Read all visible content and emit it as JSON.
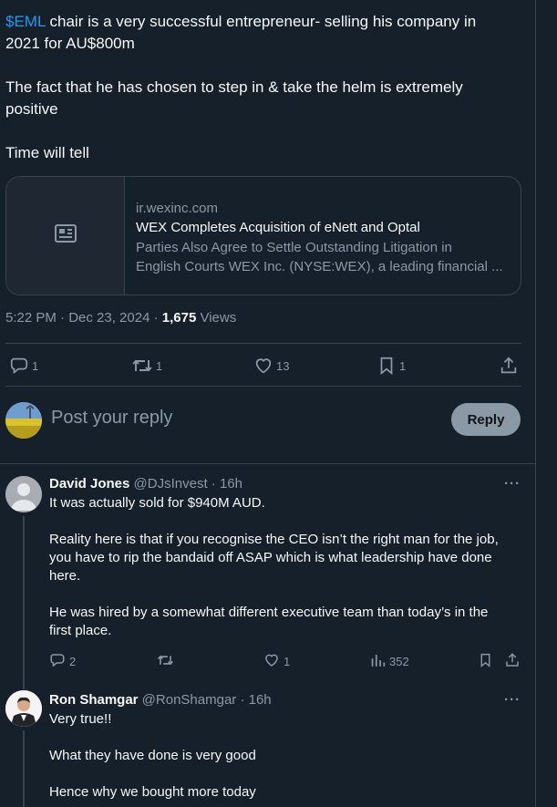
{
  "tweet": {
    "cashtag": "$EML",
    "line1_rest": " chair is a very successful entrepreneur- selling his company in",
    "line2": "2021 for AU$800m",
    "para2_l1": "The fact that he has chosen to step in & take the helm is extremely",
    "para2_l2": "positive",
    "para3": "Time will tell"
  },
  "card": {
    "domain": "ir.wexinc.com",
    "title": "WEX Completes Acquisition of eNett and Optal",
    "desc_l1": "Parties Also Agree to Settle Outstanding Litigation in",
    "desc_l2": "English Courts WEX Inc. (NYSE:WEX), a leading financial ..."
  },
  "meta": {
    "time": "5:22 PM · Dec 23, 2024 · ",
    "views_count": "1,675",
    "views_label": " Views"
  },
  "actions": {
    "replies": "1",
    "reposts": "1",
    "likes": "13",
    "bookmarks": "1"
  },
  "reply_box": {
    "placeholder": "Post your reply",
    "button": "Reply"
  },
  "replies": [
    {
      "name": "David Jones",
      "handle": " @DJsInvest · 16h",
      "more": "···",
      "p1": "It was actually sold for $940M AUD.",
      "p2_l1": "Reality here is that if you recognise the CEO isn’t the right man for the job,",
      "p2_l2": "you have to rip the bandaid off ASAP which is what leadership have done",
      "p2_l3": "here.",
      "p3_l1": "He was hired by a somewhat different executive team than today’s in the",
      "p3_l2": "first place.",
      "replies": "2",
      "likes": "1",
      "views": "352"
    },
    {
      "name": "Ron Shamgar",
      "handle": " @RonShamgar · 16h",
      "more": "···",
      "p1": "Very true!!",
      "p2": "What they have done is very good",
      "p3": "Hence why we bought more today"
    }
  ],
  "icons": {
    "reply": "speech-bubble-icon",
    "repost": "repost-arrows-icon",
    "like": "heart-icon",
    "bookmark": "bookmark-icon",
    "share": "share-upload-icon",
    "views": "bar-chart-icon",
    "card": "article-icon"
  },
  "colors": {
    "background": "#15202b",
    "accent": "#1d9bf0",
    "muted": "#8b98a5",
    "border": "#38444d"
  }
}
